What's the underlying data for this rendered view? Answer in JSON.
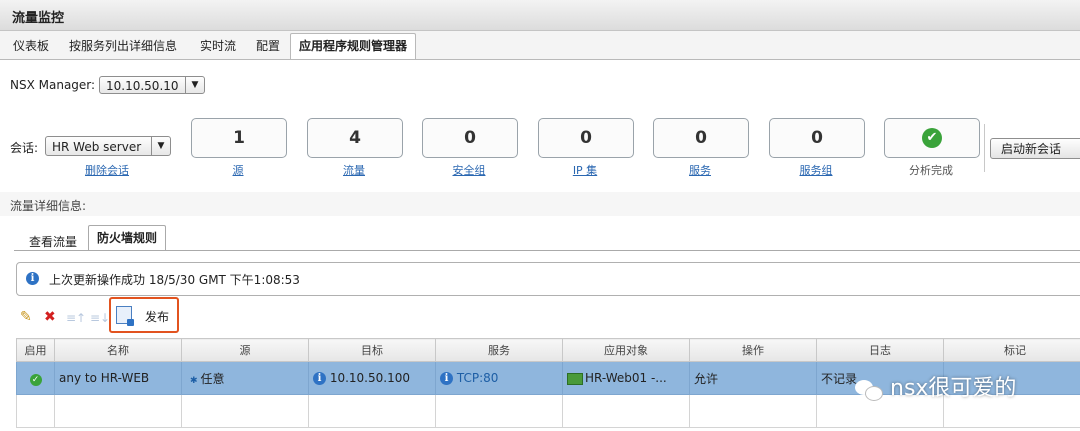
{
  "window": {
    "title": "流量监控"
  },
  "main_tabs": [
    "仪表板",
    "按服务列出详细信息",
    "实时流",
    "配置",
    "应用程序规则管理器"
  ],
  "nsx_manager": {
    "label": "NSX Manager:",
    "value": "10.10.50.10"
  },
  "session": {
    "label": "会话:",
    "value": "HR Web server",
    "delete_link": "删除会话"
  },
  "stats": [
    {
      "value": "1",
      "label": "源"
    },
    {
      "value": "4",
      "label": "流量"
    },
    {
      "value": "0",
      "label": "安全组"
    },
    {
      "value": "0",
      "label": "IP 集"
    },
    {
      "value": "0",
      "label": "服务"
    },
    {
      "value": "0",
      "label": "服务组"
    }
  ],
  "analysis": {
    "label": "分析完成",
    "status_color": "#3aa33a"
  },
  "new_session_button": "启动新会话",
  "detail_header": "流量详细信息:",
  "sub_tabs": [
    "查看流量",
    "防火墙规则"
  ],
  "info_message": "上次更新操作成功 18/5/30 GMT 下午1:08:53",
  "toolbar": {
    "publish_label": "发布",
    "highlight_color": "#e2531f"
  },
  "table": {
    "columns": [
      "启用",
      "名称",
      "源",
      "目标",
      "服务",
      "应用对象",
      "操作",
      "日志",
      "标记"
    ],
    "rows": [
      {
        "enabled": true,
        "name": "any to HR-WEB",
        "source": "任意",
        "target": "10.10.50.100",
        "service": "TCP:80",
        "app_object": "HR-Web01 -...",
        "action": "允许",
        "log": "不记录",
        "tag": ""
      }
    ]
  },
  "watermark": "nsx很可爱的"
}
